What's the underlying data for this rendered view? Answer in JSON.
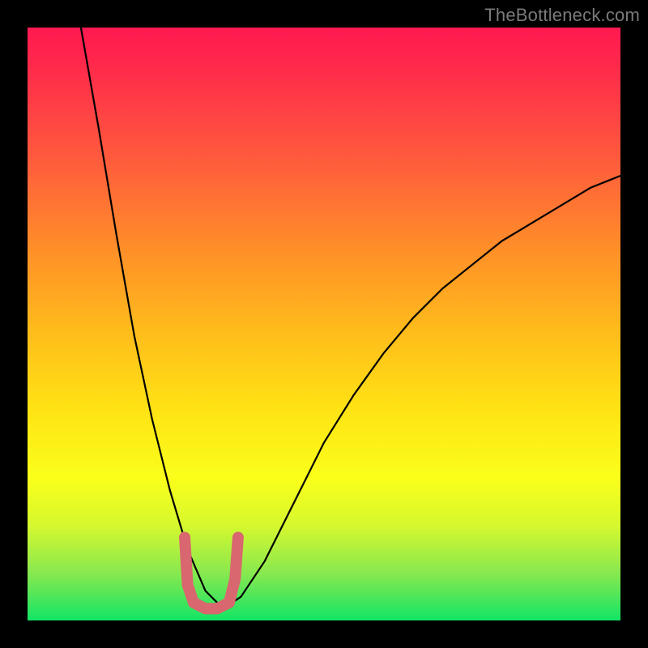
{
  "watermark": "TheBottleneck.com",
  "chart_data": {
    "type": "line",
    "title": "",
    "xlabel": "",
    "ylabel": "",
    "xlim": [
      0,
      100
    ],
    "ylim": [
      0,
      100
    ],
    "grid": false,
    "legend": false,
    "notes": "V-shaped bottleneck curve over a vertical red→yellow→green gradient background. Minimum (optimal) sits around x≈30 at y≈0. Both branches rise steeply; left branch hits top near x≈9, right branch reaches y≈75 at x=100.",
    "series": [
      {
        "name": "bottleneck-curve",
        "x": [
          9,
          12,
          15,
          18,
          21,
          24,
          27,
          30,
          33,
          36,
          40,
          45,
          50,
          55,
          60,
          65,
          70,
          75,
          80,
          85,
          90,
          95,
          100
        ],
        "values": [
          100,
          83,
          65,
          48,
          34,
          22,
          12,
          5,
          2,
          4,
          10,
          20,
          30,
          38,
          45,
          51,
          56,
          60,
          64,
          67,
          70,
          73,
          75
        ]
      }
    ],
    "highlight_region": {
      "name": "optimal-zone-vertices",
      "points_xy": [
        [
          26.5,
          14
        ],
        [
          27,
          6
        ],
        [
          28,
          3
        ],
        [
          30,
          2
        ],
        [
          32,
          2
        ],
        [
          34,
          3
        ],
        [
          35,
          7
        ],
        [
          35.5,
          14
        ]
      ]
    }
  }
}
